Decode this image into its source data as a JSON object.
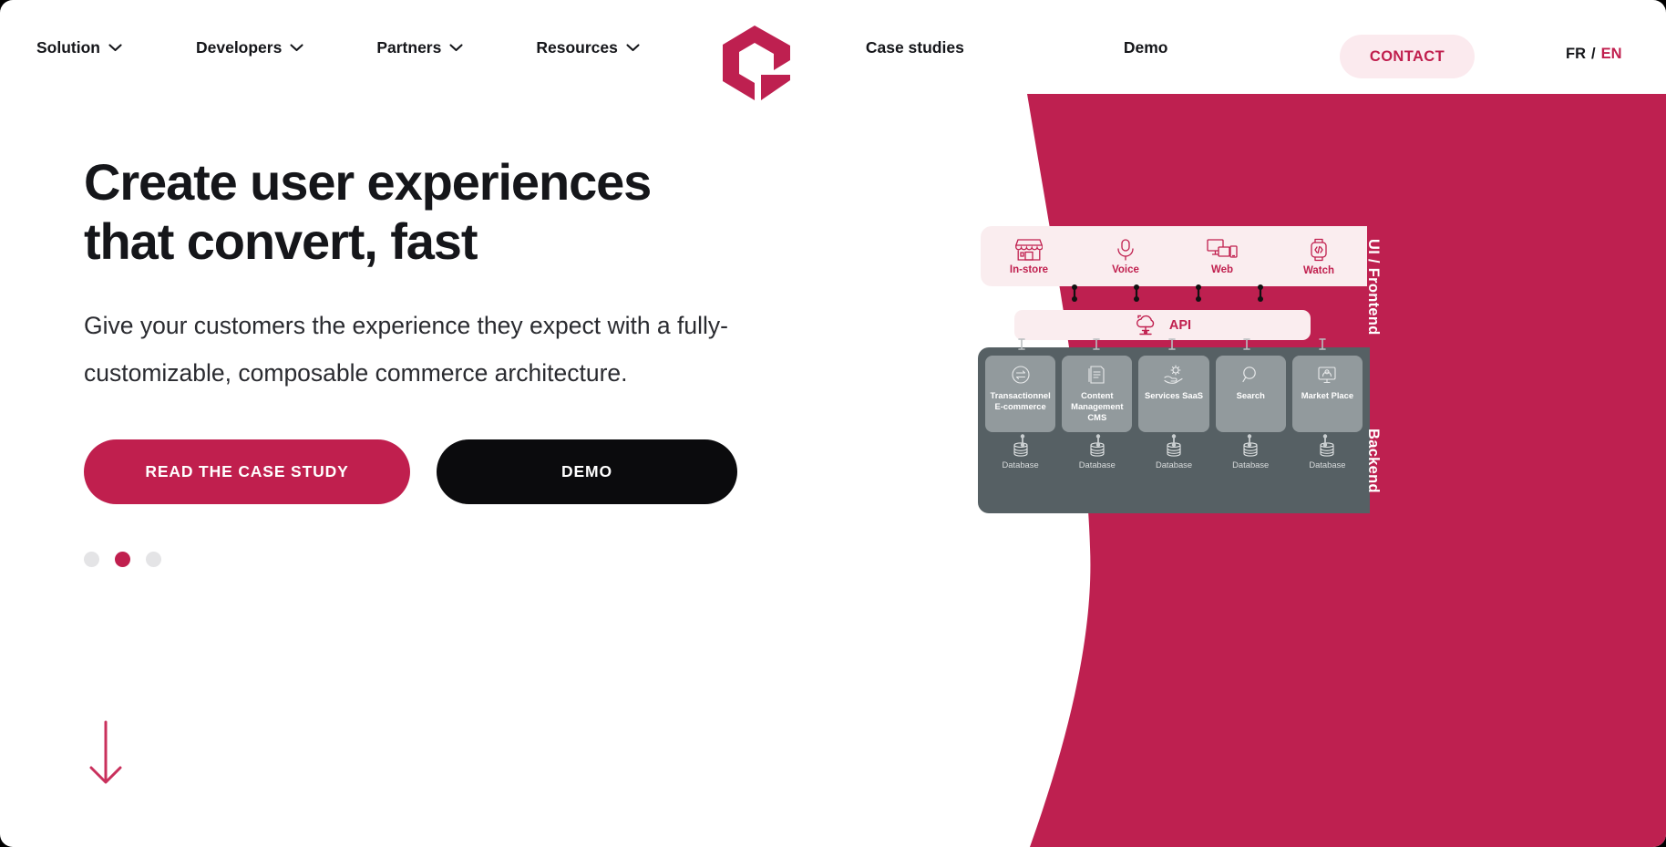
{
  "brand": {
    "accent": "#c01f4e",
    "accent_soft": "#faedef",
    "dark": "#15161a",
    "backend_gray": "#566064",
    "card_gray": "#929a9d",
    "logo_name": "composable-commerce-logo"
  },
  "nav": {
    "items": [
      {
        "label": "Solution",
        "has_dropdown": true,
        "name": "nav-item-solution"
      },
      {
        "label": "Developers",
        "has_dropdown": true,
        "name": "nav-item-developers"
      },
      {
        "label": "Partners",
        "has_dropdown": true,
        "name": "nav-item-partners"
      },
      {
        "label": "Resources",
        "has_dropdown": true,
        "name": "nav-item-resources"
      },
      {
        "label": "Case studies",
        "has_dropdown": false,
        "name": "nav-item-case-studies"
      },
      {
        "label": "Demo",
        "has_dropdown": false,
        "name": "nav-item-demo"
      }
    ],
    "contact_label": "CONTACT",
    "lang": {
      "fr": "FR",
      "separator": "/",
      "en": "EN",
      "active": "EN"
    }
  },
  "hero": {
    "headline_line1": "Create user experiences",
    "headline_line2": "that convert, fast",
    "subhead": "Give your customers the experience they expect with a fully-customizable, composable commerce architecture.",
    "cta_primary": "READ THE CASE STUDY",
    "cta_secondary": "DEMO",
    "carousel": {
      "total": 3,
      "active_index": 1
    },
    "scroll_hint_icon": "arrow-down-icon"
  },
  "diagram": {
    "frontend_label": "UI / Frontend",
    "backend_label": "Backend",
    "api_label": "API",
    "api_icon": "cloud-api-icon",
    "frontend": [
      {
        "label": "In-store",
        "icon": "storefront-icon"
      },
      {
        "label": "Voice",
        "icon": "microphone-icon"
      },
      {
        "label": "Web",
        "icon": "devices-icon"
      },
      {
        "label": "Watch",
        "icon": "smartwatch-code-icon"
      }
    ],
    "backend_services": [
      {
        "label": "Transactionnel E-commerce",
        "icon": "transaction-exchange-icon"
      },
      {
        "label": "Content Management CMS",
        "icon": "document-list-icon"
      },
      {
        "label": "Services SaaS",
        "icon": "hand-gear-icon"
      },
      {
        "label": "Search",
        "icon": "magnifier-icon"
      },
      {
        "label": "Market Place",
        "icon": "marketplace-monitor-icon"
      }
    ],
    "databases": [
      {
        "label": "Database",
        "icon": "database-cylinder-icon"
      },
      {
        "label": "Database",
        "icon": "database-cylinder-icon"
      },
      {
        "label": "Database",
        "icon": "database-cylinder-icon"
      },
      {
        "label": "Database",
        "icon": "database-cylinder-icon"
      },
      {
        "label": "Database",
        "icon": "database-cylinder-icon"
      }
    ]
  }
}
